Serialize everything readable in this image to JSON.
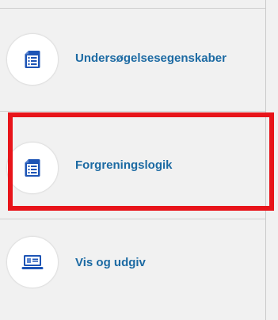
{
  "menu": {
    "items": [
      {
        "label": "Undersøgelsesegenskaber",
        "icon": "document-list-icon"
      },
      {
        "label": "Forgreningslogik",
        "icon": "document-list-icon"
      },
      {
        "label": "Vis og udgiv",
        "icon": "laptop-preview-icon"
      }
    ]
  },
  "colors": {
    "label": "#1c6aa3",
    "icon": "#1d54b5",
    "highlight": "#e8141a",
    "background": "#f1f1f1"
  }
}
